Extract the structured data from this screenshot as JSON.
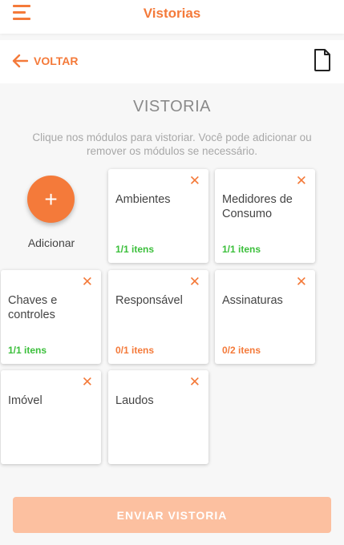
{
  "appbar": {
    "title": "Vistorias",
    "menu_icon": "hamburger-menu-icon",
    "accent_color": "#f47a3a"
  },
  "backbar": {
    "back_label": "VOLTAR",
    "back_icon": "arrow-left-icon",
    "doc_icon": "document-icon"
  },
  "main": {
    "title": "VISTORIA",
    "hint": "Clique nos módulos para vistoriar. Você pode adicionar ou remover os módulos se necessário.",
    "add_label": "Adicionar",
    "add_symbol": "+",
    "modules": [
      {
        "title": "Ambientes",
        "count": "1/1 itens",
        "status": "complete"
      },
      {
        "title": "Medidores de Consumo",
        "count": "1/1 itens",
        "status": "complete"
      },
      {
        "title": "Chaves e controles",
        "count": "1/1 itens",
        "status": "complete"
      },
      {
        "title": "Responsável",
        "count": "0/1 itens",
        "status": "pending"
      },
      {
        "title": "Assinaturas",
        "count": "0/2 itens",
        "status": "pending"
      },
      {
        "title": "Imóvel",
        "count": "",
        "status": "none"
      },
      {
        "title": "Laudos",
        "count": "",
        "status": "none"
      }
    ],
    "close_symbol": "✕"
  },
  "footer": {
    "submit_label": "ENVIAR VISTORIA",
    "submit_enabled": false
  },
  "colors": {
    "complete": "#3bbf3b",
    "pending": "#f47a3a",
    "disabled_button": "#fcc0a0"
  }
}
